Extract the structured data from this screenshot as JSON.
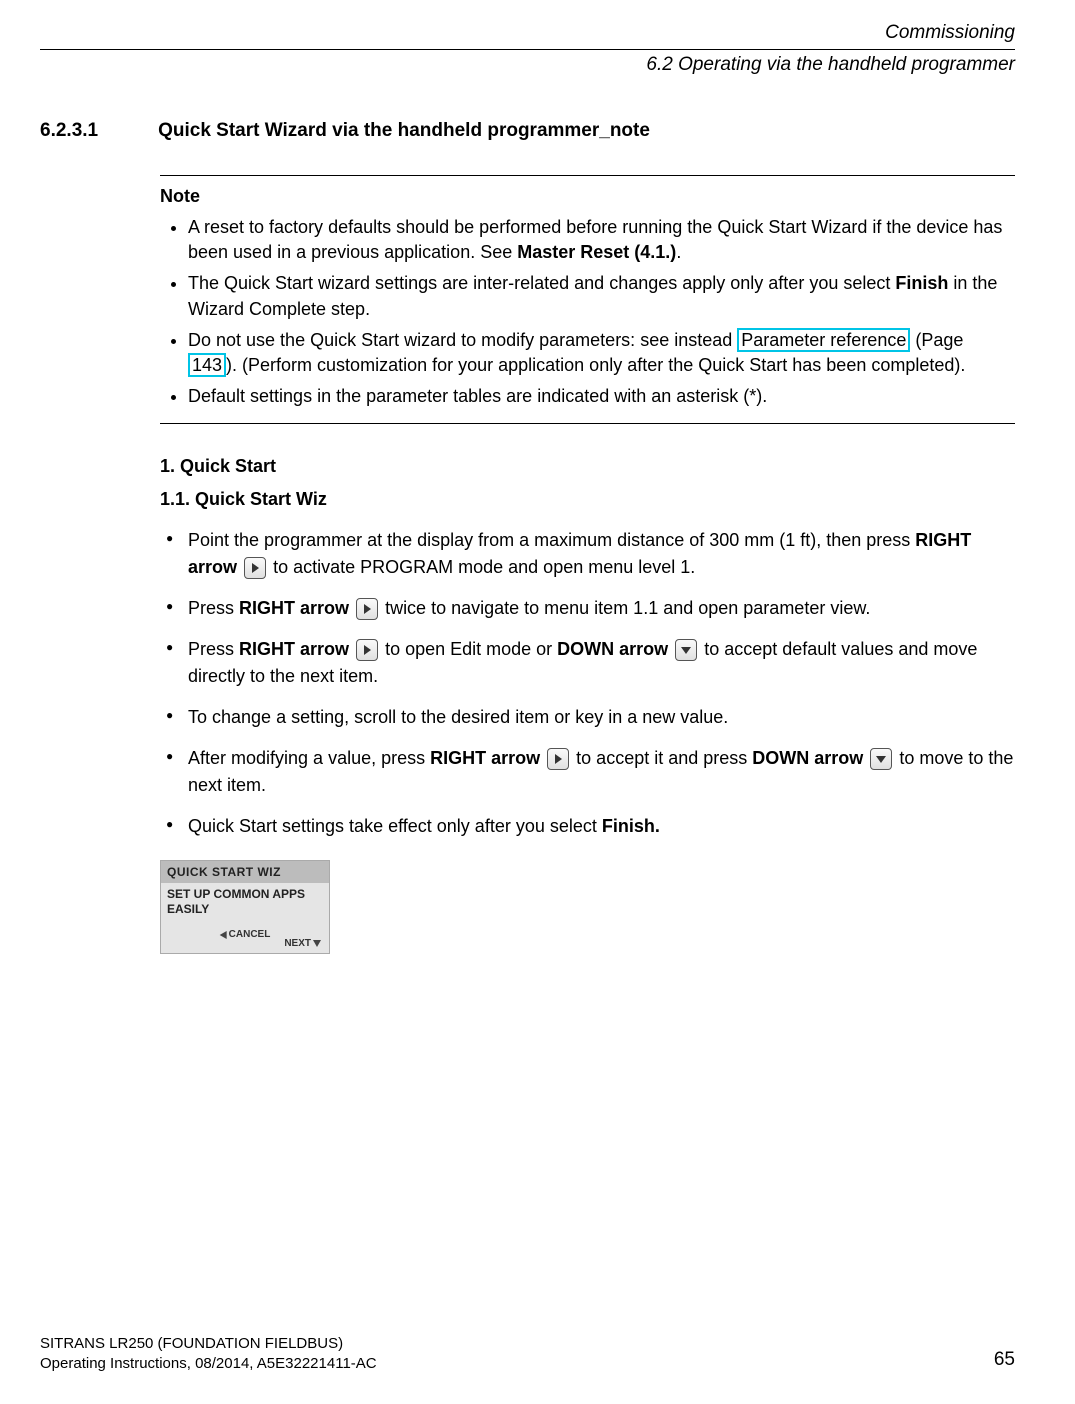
{
  "header": {
    "chapter": "Commissioning",
    "section": "6.2 Operating via the handheld programmer"
  },
  "heading": {
    "number": "6.2.3.1",
    "title": "Quick Start Wizard via the handheld programmer_note"
  },
  "note": {
    "label": "Note",
    "items": [
      {
        "pre": "A reset to factory defaults should be performed before running the Quick Start Wizard if the device has been used in a previous application. See ",
        "bold": "Master Reset (4.1.)",
        "post": "."
      },
      {
        "pre": "The Quick Start wizard settings are inter-related and changes apply only after you select ",
        "bold": "Finish",
        "post": " in the Wizard Complete step."
      },
      {
        "pre": "Do not use the Quick Start wizard to modify parameters: see instead ",
        "link_text": "Parameter reference",
        "page_label": " (Page ",
        "page_num": "143",
        "post_page": "). (Perform customization for your application only after the Quick Start has been completed)."
      },
      {
        "plain": "Default settings in the parameter tables are indicated with an asterisk (*)."
      }
    ]
  },
  "quickstart": {
    "h1": "1. Quick Start",
    "h2": "1.1. Quick Start Wiz",
    "steps": {
      "s1_a": "Point the programmer at the display from a maximum distance of 300 mm (1 ft), then press ",
      "s1_b": "RIGHT arrow",
      "s1_c": " to activate PROGRAM mode and open menu level 1.",
      "s2_a": "Press ",
      "s2_b": "RIGHT arrow",
      "s2_c": " twice to navigate to menu item 1.1 and open parameter view.",
      "s3_a": "Press ",
      "s3_b": "RIGHT arrow",
      "s3_c": " to open Edit mode or ",
      "s3_d": "DOWN arrow",
      "s3_e": " to accept default values and move directly to the next item.",
      "s4": "To change a setting, scroll to the desired item or key in a new value.",
      "s5_a": "After modifying a value, press ",
      "s5_b": "RIGHT arrow",
      "s5_c": " to accept it and press ",
      "s5_d": "DOWN arrow",
      "s5_e": " to move to the next item.",
      "s6_a": "Quick Start settings take effect only after you select ",
      "s6_b": "Finish."
    }
  },
  "lcd": {
    "title": "QUICK START WIZ",
    "line1": "SET UP COMMON APPS",
    "line2": "EASILY",
    "cancel": "CANCEL",
    "next": "NEXT"
  },
  "footer": {
    "line1": "SITRANS LR250 (FOUNDATION FIELDBUS)",
    "line2": "Operating Instructions, 08/2014, A5E32221411-AC",
    "page": "65"
  }
}
